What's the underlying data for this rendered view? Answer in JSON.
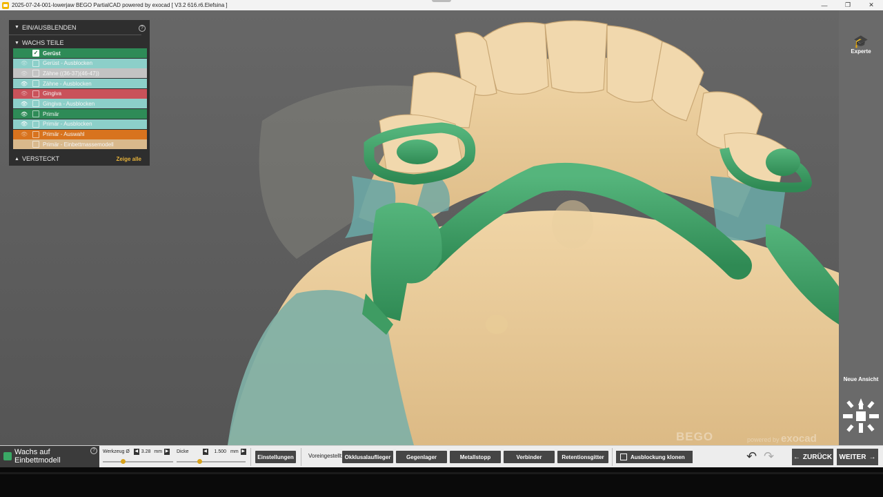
{
  "window": {
    "title": "2025-07-24-001-lowerjaw BEGO PartialCAD powered by exocad [ V3.2 616.r6.Elefsina ]",
    "minimize": "—",
    "maximize": "❐",
    "close": "✕"
  },
  "panel": {
    "header": "EIN/AUSBLENDEN",
    "help": "?",
    "section_title": "WACHS TEILE",
    "layers": [
      {
        "label": "Gerüst",
        "color": "#2e8b57",
        "visible": null,
        "checked": true
      },
      {
        "label": "Gerüst - Ausblocken",
        "color": "#8ccfc9",
        "visible": false,
        "checked": false
      },
      {
        "label": "Zähne ((36-37)(46-47))",
        "color": "#c3c3c3",
        "visible": false,
        "checked": false
      },
      {
        "label": "Zähne - Ausblocken",
        "color": "#8ccfc9",
        "visible": true,
        "checked": false
      },
      {
        "label": "Gingiva",
        "color": "#c9525a",
        "visible": false,
        "checked": false
      },
      {
        "label": "Gingiva - Ausblocken",
        "color": "#8ccfc9",
        "visible": true,
        "checked": false
      },
      {
        "label": "Primär",
        "color": "#2e8b57",
        "visible": true,
        "checked": false
      },
      {
        "label": "Primär - Ausblocken",
        "color": "#8ccfc9",
        "visible": true,
        "checked": false
      },
      {
        "label": "Primär - Auswahl",
        "color": "#d8731e",
        "visible": false,
        "checked": false
      },
      {
        "label": "Primär - Einbettmassemodell",
        "color": "#d9b98c",
        "visible": null,
        "checked": false
      }
    ],
    "hidden_title": "VERSTECKT",
    "show_all": "Zeige alle"
  },
  "right_toolbar": {
    "expert_label": "Experte",
    "new_view_label": "Neue Ansicht"
  },
  "watermark": {
    "brand": "BEGO",
    "powered": "powered by",
    "exocad": "exocad"
  },
  "bottom": {
    "wachs_label_1": "Wachs auf",
    "wachs_label_2": "Einbettmodell",
    "help": "?",
    "tool_label": "Werkzeug Ø",
    "tool_value": "3.28",
    "tool_unit": "mm",
    "tool_slider": 0.25,
    "thickness_label": "Dicke",
    "thickness_value": "1.500",
    "thickness_unit": "mm",
    "thickness_slider": 0.3,
    "settings": "Einstellungen",
    "preset_label": "Voreingestellt:",
    "presets": [
      "Okklusalauflieger",
      "Gegenlager",
      "Metallstopp",
      "Verbinder",
      "Retentionsgitter"
    ],
    "clone_label": "Ausblockung klonen",
    "back": "ZURÜCK",
    "next": "WEITER"
  },
  "colors": {
    "model": "#e2c28f",
    "wax": "#3f9c63",
    "blockout": "#6aa6a4",
    "accent": "#d8a21a"
  }
}
